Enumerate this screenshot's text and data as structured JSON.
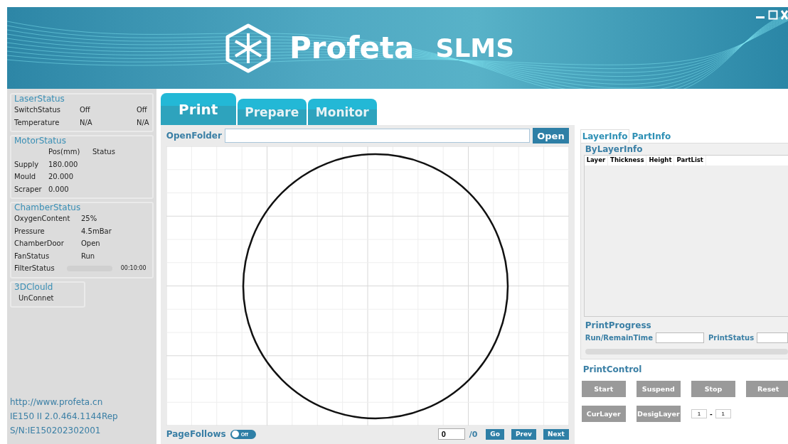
{
  "header": {
    "brand": "Profeta",
    "product": "SLMS"
  },
  "status_groups": [
    {
      "kind": "laser",
      "title": "LaserStatus",
      "rows": [
        {
          "kind": "text",
          "cells": [
            "SwitchStatus",
            "Off",
            "Off"
          ]
        },
        {
          "kind": "text",
          "cells": [
            "Temperature",
            "N/A",
            "N/A"
          ]
        }
      ]
    },
    {
      "kind": "motor",
      "title": "MotorStatus",
      "header": [
        "Pos(mm)",
        "Status"
      ],
      "rows": [
        {
          "kind": "text",
          "cells": [
            "Supply",
            "180.000"
          ]
        },
        {
          "kind": "text",
          "cells": [
            "Mould",
            "20.000"
          ]
        },
        {
          "kind": "text",
          "cells": [
            "Scraper",
            "0.000"
          ]
        }
      ]
    },
    {
      "kind": "chamber",
      "title": "ChamberStatus",
      "rows": [
        {
          "kind": "text",
          "cells": [
            "OxygenContent",
            "25%"
          ]
        },
        {
          "kind": "text",
          "cells": [
            "Pressure",
            "4.5mBar"
          ]
        },
        {
          "kind": "text",
          "cells": [
            "ChamberDoor",
            "Open"
          ]
        },
        {
          "kind": "text",
          "cells": [
            "FanStatus",
            "Run"
          ]
        },
        {
          "kind": "meter",
          "cells": [
            "FilterStatus",
            "00:10:00"
          ],
          "level": 0
        }
      ]
    },
    {
      "kind": "cloud",
      "title": "3DClould",
      "rows": [
        {
          "kind": "text",
          "cells": [
            "UnConnet"
          ]
        }
      ]
    }
  ],
  "footer": {
    "url": "http://www.profeta.cn",
    "version": "IE150 II 2.0.464.1144Rep",
    "serial": "S/N:IE150202302001"
  },
  "tabs": [
    {
      "label": "Print",
      "selected": true
    },
    {
      "label": "Prepare",
      "selected": false
    },
    {
      "label": "Monitor",
      "selected": false
    }
  ],
  "open_folder": {
    "label": "OpenFolder",
    "button": "Open"
  },
  "bottom_bar": {
    "label": "PageFollows",
    "toggle": {
      "on": false,
      "label": "Off"
    },
    "page": "0",
    "total": "/0",
    "buttons": [
      "Go",
      "Prev",
      "Next"
    ]
  },
  "info_tabs": [
    {
      "label": "LayerInfo",
      "selected": true
    },
    {
      "label": "PartInfo",
      "selected": false
    }
  ],
  "layer_info": {
    "title": "ByLayerInfo",
    "columns": [
      "Layer",
      "Thickness",
      "Height",
      "PartList"
    ]
  },
  "print_progress": {
    "title": "PrintProgress",
    "fields": [
      {
        "label": "Run/RemainTime"
      },
      {
        "label": "PrintStatus"
      }
    ],
    "level": 0
  },
  "print_control": {
    "title": "PrintControl",
    "buttons": [
      {
        "label": "Start",
        "disabled": true
      },
      {
        "label": "Suspend",
        "disabled": true
      },
      {
        "label": "Stop",
        "disabled": true
      },
      {
        "label": "Reset",
        "disabled": true
      },
      {
        "label": "CurLayer",
        "disabled": true
      },
      {
        "label": "DesigLayer",
        "disabled": true
      }
    ],
    "layer_from": "1",
    "separator": "-",
    "layer_to": "1"
  }
}
